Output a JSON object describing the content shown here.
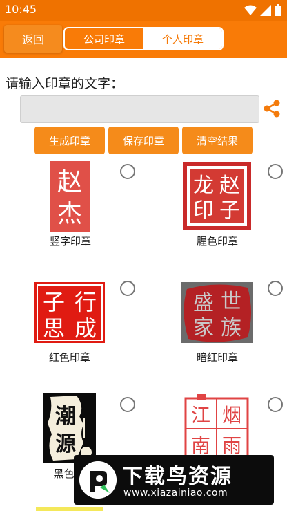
{
  "status": {
    "time": "10:45"
  },
  "toolbar": {
    "back_label": "返回",
    "tabs": [
      {
        "label": "公司印章",
        "active": false
      },
      {
        "label": "个人印章",
        "active": true
      }
    ]
  },
  "form": {
    "prompt": "请输入印章的文字：",
    "input_value": "",
    "input_placeholder": ""
  },
  "actions": {
    "generate": "生成印章",
    "save": "保存印章",
    "clear": "清空结果"
  },
  "seals": [
    {
      "caption": "竖字印章",
      "chars": [
        "赵",
        "杰"
      ],
      "selected": false
    },
    {
      "caption": "腥色印章",
      "chars": [
        "龙",
        "赵",
        "印",
        "子"
      ],
      "selected": false
    },
    {
      "caption": "红色印章",
      "chars": [
        "行",
        "子",
        "成",
        "思"
      ],
      "selected": false
    },
    {
      "caption": "暗红印章",
      "chars": [
        "盛",
        "世",
        "家",
        "族"
      ],
      "selected": false
    },
    {
      "caption": "黑色印",
      "chars": [
        "潮",
        "源"
      ],
      "selected": false
    },
    {
      "caption": "",
      "chars": [
        "烟",
        "雨",
        "江",
        "南"
      ],
      "selected": false
    }
  ],
  "watermark": {
    "title": "下载鸟资源",
    "url": "www.xiazainiao.com"
  },
  "colors": {
    "accent": "#f97b07",
    "status_bar": "#ef7200",
    "button": "#f58b1a",
    "seal_red": "#d8342c"
  },
  "icons": [
    "wifi-icon",
    "signal-icon",
    "battery-icon",
    "share-icon",
    "radio-icon"
  ]
}
